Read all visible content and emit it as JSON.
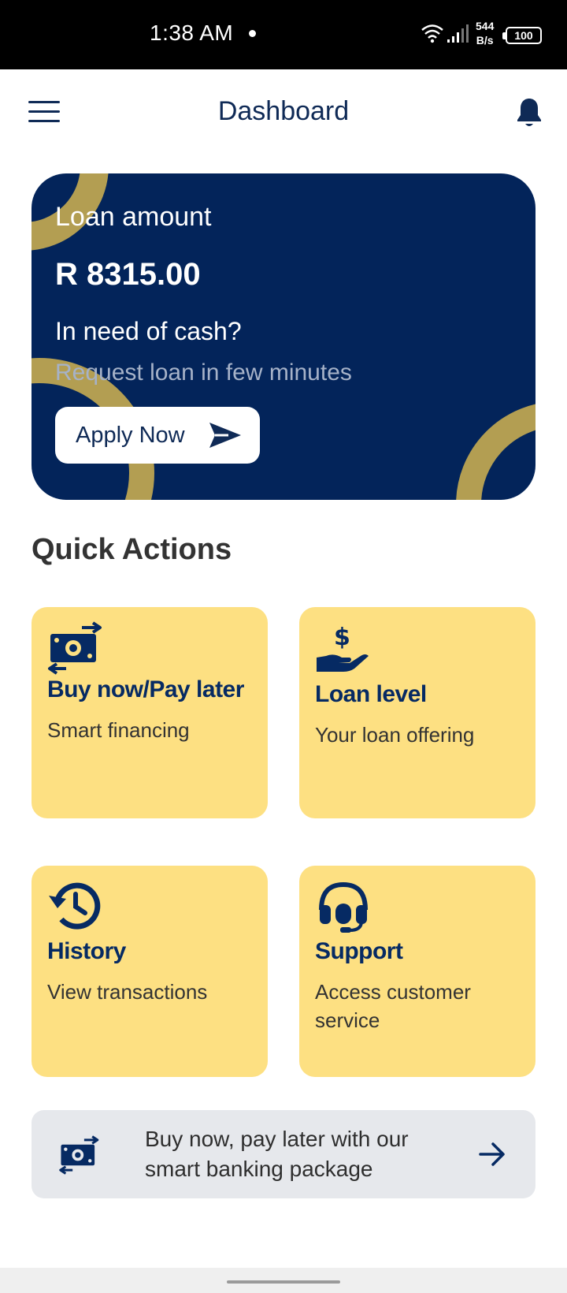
{
  "status_bar": {
    "time": "1:38 AM",
    "speed_value": "544",
    "speed_unit": "B/s",
    "battery": "100",
    "icons": [
      "wifi-icon",
      "signal-icon",
      "battery-icon"
    ]
  },
  "header": {
    "title": "Dashboard",
    "icons": {
      "menu": "menu-icon",
      "notifications": "bell-icon"
    }
  },
  "loan_card": {
    "label": "Loan amount",
    "amount": "R 8315.00",
    "prompt": "In need of cash?",
    "subtitle": "Request loan in few minutes",
    "apply_label": "Apply Now",
    "apply_icon": "send-icon",
    "colors": {
      "background": "#03245a",
      "accent": "#b39e52"
    }
  },
  "quick_actions": {
    "title": "Quick Actions",
    "items": [
      {
        "title": "Buy now/Pay later",
        "description": "Smart financing",
        "icon": "money-transfer-icon"
      },
      {
        "title": "Loan level",
        "description": "Your loan offering",
        "icon": "hand-dollar-icon"
      },
      {
        "title": "History",
        "description": "View transactions",
        "icon": "history-icon"
      },
      {
        "title": "Support",
        "description": "Access customer service",
        "icon": "headset-icon"
      }
    ],
    "card_color": "#fde082"
  },
  "promo": {
    "text": "Buy now, pay later with our smart banking package",
    "icon": "money-transfer-icon",
    "action_icon": "arrow-right-icon"
  },
  "colors": {
    "primary": "#062a63"
  }
}
